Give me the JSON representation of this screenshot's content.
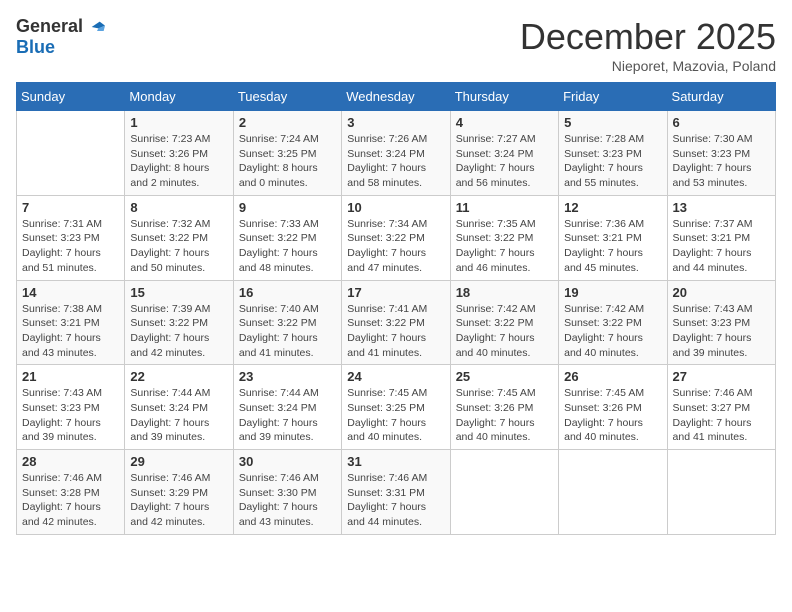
{
  "logo": {
    "general": "General",
    "blue": "Blue"
  },
  "title": "December 2025",
  "subtitle": "Nieporet, Mazovia, Poland",
  "days_header": [
    "Sunday",
    "Monday",
    "Tuesday",
    "Wednesday",
    "Thursday",
    "Friday",
    "Saturday"
  ],
  "weeks": [
    [
      {
        "day": "",
        "info": ""
      },
      {
        "day": "1",
        "info": "Sunrise: 7:23 AM\nSunset: 3:26 PM\nDaylight: 8 hours\nand 2 minutes."
      },
      {
        "day": "2",
        "info": "Sunrise: 7:24 AM\nSunset: 3:25 PM\nDaylight: 8 hours\nand 0 minutes."
      },
      {
        "day": "3",
        "info": "Sunrise: 7:26 AM\nSunset: 3:24 PM\nDaylight: 7 hours\nand 58 minutes."
      },
      {
        "day": "4",
        "info": "Sunrise: 7:27 AM\nSunset: 3:24 PM\nDaylight: 7 hours\nand 56 minutes."
      },
      {
        "day": "5",
        "info": "Sunrise: 7:28 AM\nSunset: 3:23 PM\nDaylight: 7 hours\nand 55 minutes."
      },
      {
        "day": "6",
        "info": "Sunrise: 7:30 AM\nSunset: 3:23 PM\nDaylight: 7 hours\nand 53 minutes."
      }
    ],
    [
      {
        "day": "7",
        "info": "Sunrise: 7:31 AM\nSunset: 3:23 PM\nDaylight: 7 hours\nand 51 minutes."
      },
      {
        "day": "8",
        "info": "Sunrise: 7:32 AM\nSunset: 3:22 PM\nDaylight: 7 hours\nand 50 minutes."
      },
      {
        "day": "9",
        "info": "Sunrise: 7:33 AM\nSunset: 3:22 PM\nDaylight: 7 hours\nand 48 minutes."
      },
      {
        "day": "10",
        "info": "Sunrise: 7:34 AM\nSunset: 3:22 PM\nDaylight: 7 hours\nand 47 minutes."
      },
      {
        "day": "11",
        "info": "Sunrise: 7:35 AM\nSunset: 3:22 PM\nDaylight: 7 hours\nand 46 minutes."
      },
      {
        "day": "12",
        "info": "Sunrise: 7:36 AM\nSunset: 3:21 PM\nDaylight: 7 hours\nand 45 minutes."
      },
      {
        "day": "13",
        "info": "Sunrise: 7:37 AM\nSunset: 3:21 PM\nDaylight: 7 hours\nand 44 minutes."
      }
    ],
    [
      {
        "day": "14",
        "info": "Sunrise: 7:38 AM\nSunset: 3:21 PM\nDaylight: 7 hours\nand 43 minutes."
      },
      {
        "day": "15",
        "info": "Sunrise: 7:39 AM\nSunset: 3:22 PM\nDaylight: 7 hours\nand 42 minutes."
      },
      {
        "day": "16",
        "info": "Sunrise: 7:40 AM\nSunset: 3:22 PM\nDaylight: 7 hours\nand 41 minutes."
      },
      {
        "day": "17",
        "info": "Sunrise: 7:41 AM\nSunset: 3:22 PM\nDaylight: 7 hours\nand 41 minutes."
      },
      {
        "day": "18",
        "info": "Sunrise: 7:42 AM\nSunset: 3:22 PM\nDaylight: 7 hours\nand 40 minutes."
      },
      {
        "day": "19",
        "info": "Sunrise: 7:42 AM\nSunset: 3:22 PM\nDaylight: 7 hours\nand 40 minutes."
      },
      {
        "day": "20",
        "info": "Sunrise: 7:43 AM\nSunset: 3:23 PM\nDaylight: 7 hours\nand 39 minutes."
      }
    ],
    [
      {
        "day": "21",
        "info": "Sunrise: 7:43 AM\nSunset: 3:23 PM\nDaylight: 7 hours\nand 39 minutes."
      },
      {
        "day": "22",
        "info": "Sunrise: 7:44 AM\nSunset: 3:24 PM\nDaylight: 7 hours\nand 39 minutes."
      },
      {
        "day": "23",
        "info": "Sunrise: 7:44 AM\nSunset: 3:24 PM\nDaylight: 7 hours\nand 39 minutes."
      },
      {
        "day": "24",
        "info": "Sunrise: 7:45 AM\nSunset: 3:25 PM\nDaylight: 7 hours\nand 40 minutes."
      },
      {
        "day": "25",
        "info": "Sunrise: 7:45 AM\nSunset: 3:26 PM\nDaylight: 7 hours\nand 40 minutes."
      },
      {
        "day": "26",
        "info": "Sunrise: 7:45 AM\nSunset: 3:26 PM\nDaylight: 7 hours\nand 40 minutes."
      },
      {
        "day": "27",
        "info": "Sunrise: 7:46 AM\nSunset: 3:27 PM\nDaylight: 7 hours\nand 41 minutes."
      }
    ],
    [
      {
        "day": "28",
        "info": "Sunrise: 7:46 AM\nSunset: 3:28 PM\nDaylight: 7 hours\nand 42 minutes."
      },
      {
        "day": "29",
        "info": "Sunrise: 7:46 AM\nSunset: 3:29 PM\nDaylight: 7 hours\nand 42 minutes."
      },
      {
        "day": "30",
        "info": "Sunrise: 7:46 AM\nSunset: 3:30 PM\nDaylight: 7 hours\nand 43 minutes."
      },
      {
        "day": "31",
        "info": "Sunrise: 7:46 AM\nSunset: 3:31 PM\nDaylight: 7 hours\nand 44 minutes."
      },
      {
        "day": "",
        "info": ""
      },
      {
        "day": "",
        "info": ""
      },
      {
        "day": "",
        "info": ""
      }
    ]
  ]
}
